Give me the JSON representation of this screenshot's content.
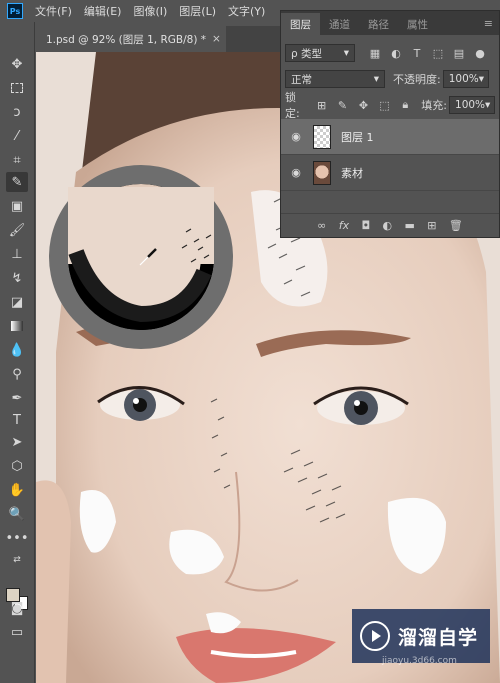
{
  "app": {
    "logo": "Ps"
  },
  "menubar": {
    "items": [
      "文件(F)",
      "编辑(E)",
      "图像(I)",
      "图层(L)",
      "文字(Y)"
    ]
  },
  "document": {
    "tab_title": "1.psd @ 92% (图层 1, RGB/8) *",
    "close_glyph": "×"
  },
  "toolbar": {
    "tools": [
      "move-tool",
      "marquee-tool",
      "lasso-tool",
      "magic-wand-tool",
      "crop-tool",
      "eyedropper-tool",
      "spot-healing-tool",
      "brush-tool",
      "clone-stamp-tool",
      "history-brush-tool",
      "eraser-tool",
      "gradient-tool",
      "blur-tool",
      "dodge-tool",
      "pen-tool",
      "type-tool",
      "path-selection-tool",
      "shape-tool",
      "hand-tool",
      "zoom-tool",
      "more-tools"
    ],
    "active_tool": "eyedropper-tool",
    "foreground_color": "#ddd4c4",
    "background_color": "#ffffff"
  },
  "layers_panel": {
    "tabs": [
      "图层",
      "通道",
      "路径",
      "属性"
    ],
    "active_tab": "图层",
    "filter_label": "ρ 类型",
    "blend_mode": "正常",
    "opacity_label": "不透明度:",
    "opacity_value": "100%",
    "lock_label": "锁定:",
    "fill_label": "填充:",
    "fill_value": "100%",
    "layers": [
      {
        "name": "图层 1",
        "visible": true,
        "selected": true,
        "thumb": "transparent"
      },
      {
        "name": "素材",
        "visible": true,
        "selected": false,
        "thumb": "face"
      }
    ]
  },
  "loupe": {
    "sampled_color": "#e2cbbb",
    "previous_color": "#000000",
    "ring_color": "#6e6e6e"
  },
  "watermark": {
    "text": "溜溜自学",
    "url": "jiaoyu.3d66.com"
  }
}
